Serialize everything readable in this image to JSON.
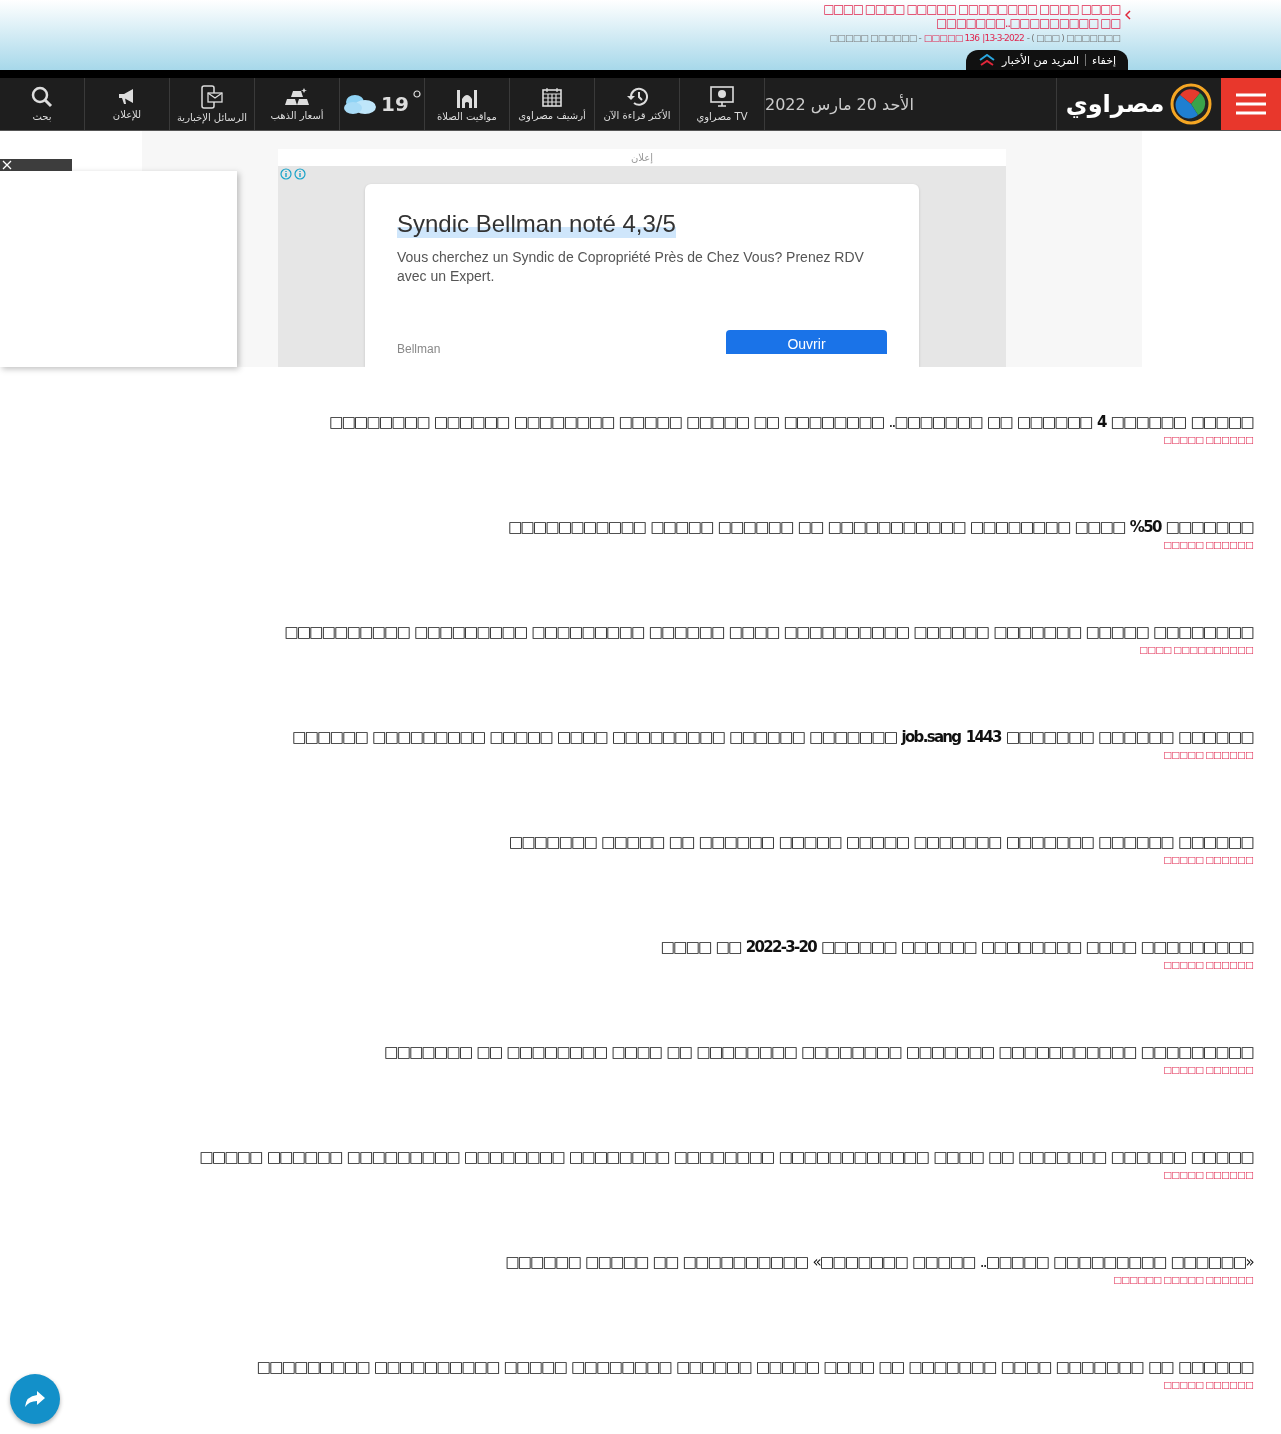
{
  "ticker": {
    "headline": "□□□□ □□□□ □□□□□□□□ □□□□□ □□□□ □□□□ □□ □□□□□□□□□..□□□□□□□",
    "meta": {
      "section": "□□□□□ □□□□□□ -",
      "views": "□□□□□ 136",
      "date": "|13-3-2022",
      "source": "- ( □□□ ) □□□□□□□"
    }
  },
  "more_tab": {
    "hide": "إخفاء",
    "more": "المزيد من الأخبار"
  },
  "nav": {
    "items": [
      {
        "kind": "tv",
        "label": "مصراوي TV"
      },
      {
        "kind": "popular",
        "label": "الأكثر قراءة الآن"
      },
      {
        "kind": "archive",
        "label": "أرشيف مصراوى"
      },
      {
        "kind": "prayer",
        "label": "مواقيت الصلاة"
      },
      {
        "kind": "weather",
        "label": "19"
      },
      {
        "kind": "gold",
        "label": "أسعار الذهب"
      },
      {
        "kind": "newsletter",
        "label": "الرسائل الإخبارية"
      },
      {
        "kind": "ads",
        "label": "للإعلان"
      },
      {
        "kind": "search",
        "label": "بحث"
      }
    ],
    "date": "الأحد 20 مارس 2022",
    "logo": "مصراوي"
  },
  "ad": {
    "label": "إعلان",
    "title": "Syndic Bellman noté 4,3/5",
    "text": "Vous cherchez un Syndic de Copropriété Près de Chez Vous? Prenez RDV avec un Expert.",
    "advertiser": "Bellman",
    "button": "Ouvrir"
  },
  "headlines": [
    {
      "title": "□□□□□□□□ □□□□□□ □□□□□□□□ □□□□□ □□□□□ □□ □□□□□□□□ ..□□□□□□□ □□ □□□□□□ **4** □□□□□□ □□□□□",
      "category": "□□□□□ □□□□□□"
    },
    {
      "title": "□□□□□□□□□□□ □□□□□ □□□□□□ □□ □□□□□□□□□□□ □□□□□□□□ □□□□ **%50** □□□□□□□",
      "category": "□□□□□ □□□□□□"
    },
    {
      "title": "□□□□□□□□□□ □□□□□□□□□ □□□□□□□□□ □□□□□□ □□□□ □□□□□□□□□□ □□□□□□ □□□□□□□ □□□□□ □□□□□□□□",
      "category": "□□□□ □□□□□□□□□□"
    },
    {
      "title": "□□□□□□ □□□□□□□□□ □□□□□ □□□□ □□□□□□□□□ □□□□□□ □□□□□□□ **job.sang 1443** □□□□□□□ □□□□□□ □□□□□□",
      "category": "□□□□□ □□□□□□"
    },
    {
      "title": "□□□□□□□ □□□□□ □□ □□□□□□ □□□□□ □□□□□ □□□□□□□ □□□□□□□ □□□□□□ □□□□□□",
      "category": "□□□□□ □□□□□□"
    },
    {
      "title": "□□□□ □□ **2022-3-20** □□□□□□ □□□□□□ □□□□□□□□ □□□□ □□□□□□□□□",
      "category": "□□□□□ □□□□□□"
    },
    {
      "title": "□□□□□□□ □□ □□□□□□□□ □□□□ □□ □□□□□□□□ □□□□□□□□ □□□□□□□ □□□□□□□□□□□ □□□□□□□□□",
      "category": "□□□□□ □□□□□□"
    },
    {
      "title": "□□□□□ □□□□□□ □□□□□□□□□ □□□□□□□□ □□□□□□□□ □□□□□□□□ □□□□□□□□□□□□ □□□□ □□ □□□□□□□ □□□□□□ □□□□□",
      "category": "□□□□□ □□□□□□"
    },
    {
      "title": "□□□□□□ □□□□□ □□ □□□□□□□□□□ «□□□□□□□ □□□□□ ..□□□□□ □□□□□□□□□ □□□□□□»",
      "category": "□□□□□□ □□□□□ □□□□□□"
    },
    {
      "title": "□□□□□□□□□ □□□□□□□□□□ □□□□□ □□□□□□□□ □□□□□□ □□□□□ □□□□ □□ □□□□□□□ □□□□ □□□□□□□ □□ □□□□□□",
      "category": "□□□□□ □□□□□□"
    }
  ]
}
